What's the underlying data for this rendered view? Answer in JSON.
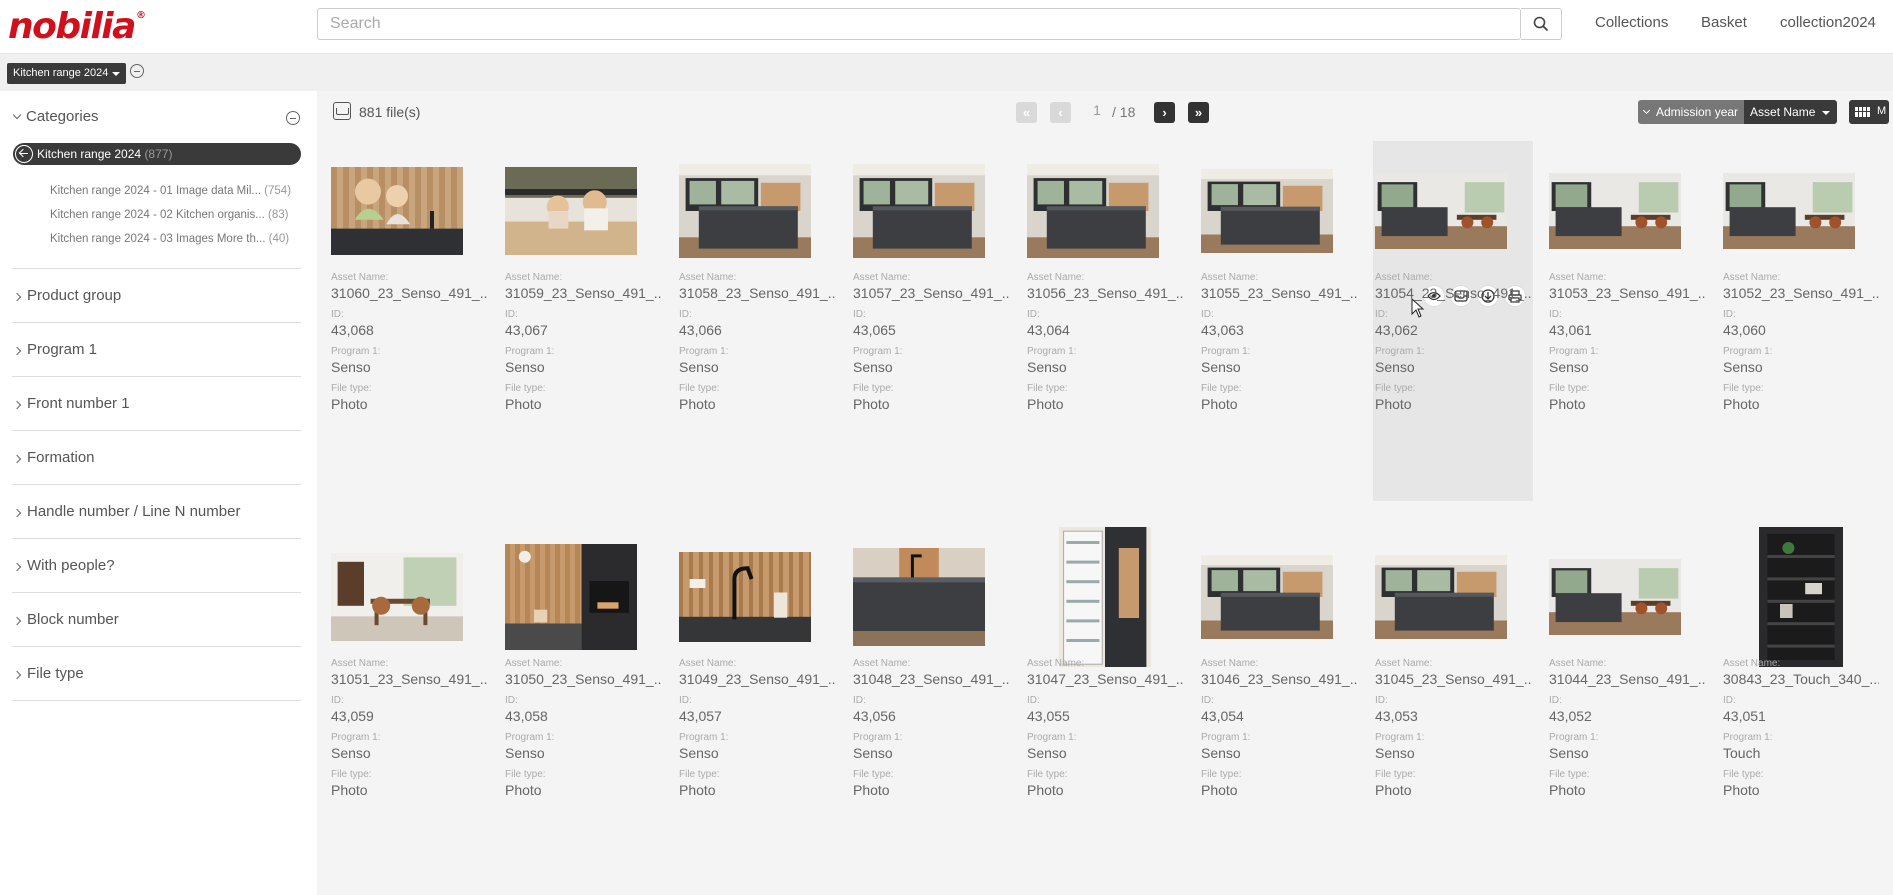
{
  "header": {
    "logo": "nobilia",
    "logo_mark": "®",
    "search_placeholder": "Search",
    "nav": [
      "Collections",
      "Basket",
      "collection2024"
    ]
  },
  "subbar": {
    "scope": "Kitchen range 2024"
  },
  "sidebar": {
    "categories_label": "Categories",
    "active": {
      "label": "Kitchen range 2024",
      "count": "(877)"
    },
    "subcategories": [
      {
        "label": "Kitchen range 2024 - 01 Image data Mil...",
        "count": "(754)"
      },
      {
        "label": "Kitchen range 2024 - 02 Kitchen organis...",
        "count": "(83)"
      },
      {
        "label": "Kitchen range 2024 - 03 Images More th...",
        "count": "(40)"
      }
    ],
    "filters": [
      "Product group",
      "Program 1",
      "Front number 1",
      "Formation",
      "Handle number / Line N number",
      "With people?",
      "Block number",
      "File type"
    ]
  },
  "toolbar": {
    "files_count": "881 file(s)",
    "page": "1",
    "page_total": "/ 18",
    "sort_admission": "Admission year",
    "sort_name": "Asset Name",
    "view_label": "M"
  },
  "labels": {
    "asset_name": "Asset Name:",
    "id": "ID:",
    "program": "Program 1:",
    "file_type": "File type:"
  },
  "assets": [
    {
      "name": "31060_23_Senso_491_...",
      "id": "43,068",
      "program": "Senso",
      "file_type": "Photo",
      "scene": "people-kitchen"
    },
    {
      "name": "31059_23_Senso_491_...",
      "id": "43,067",
      "program": "Senso",
      "file_type": "Photo",
      "scene": "people-table"
    },
    {
      "name": "31058_23_Senso_491_...",
      "id": "43,066",
      "program": "Senso",
      "file_type": "Photo",
      "scene": "island"
    },
    {
      "name": "31057_23_Senso_491_...",
      "id": "43,065",
      "program": "Senso",
      "file_type": "Photo",
      "scene": "island"
    },
    {
      "name": "31056_23_Senso_491_...",
      "id": "43,064",
      "program": "Senso",
      "file_type": "Photo",
      "scene": "island"
    },
    {
      "name": "31055_23_Senso_491_...",
      "id": "43,063",
      "program": "Senso",
      "file_type": "Photo",
      "scene": "island-wide"
    },
    {
      "name": "31054_23_Senso_491_...",
      "id": "43,062",
      "program": "Senso",
      "file_type": "Photo",
      "scene": "room"
    },
    {
      "name": "31053_23_Senso_491_...",
      "id": "43,061",
      "program": "Senso",
      "file_type": "Photo",
      "scene": "room"
    },
    {
      "name": "31052_23_Senso_491_...",
      "id": "43,060",
      "program": "Senso",
      "file_type": "Photo",
      "scene": "room"
    },
    {
      "name": "31051_23_Senso_491_...",
      "id": "43,059",
      "program": "Senso",
      "file_type": "Photo",
      "scene": "dining"
    },
    {
      "name": "31050_23_Senso_491_...",
      "id": "43,058",
      "program": "Senso",
      "file_type": "Photo",
      "scene": "oven"
    },
    {
      "name": "31049_23_Senso_491_...",
      "id": "43,057",
      "program": "Senso",
      "file_type": "Photo",
      "scene": "tap"
    },
    {
      "name": "31048_23_Senso_491_...",
      "id": "43,056",
      "program": "Senso",
      "file_type": "Photo",
      "scene": "corner"
    },
    {
      "name": "31047_23_Senso_491_...",
      "id": "43,055",
      "program": "Senso",
      "file_type": "Photo",
      "scene": "fridge"
    },
    {
      "name": "31046_23_Senso_491_...",
      "id": "43,054",
      "program": "Senso",
      "file_type": "Photo",
      "scene": "island-wide"
    },
    {
      "name": "31045_23_Senso_491_...",
      "id": "43,053",
      "program": "Senso",
      "file_type": "Photo",
      "scene": "island-wide"
    },
    {
      "name": "31044_23_Senso_491_...",
      "id": "43,052",
      "program": "Senso",
      "file_type": "Photo",
      "scene": "room"
    },
    {
      "name": "30843_23_Touch_340_...",
      "id": "43,051",
      "program": "Touch",
      "file_type": "Photo",
      "scene": "shelf"
    }
  ],
  "card_actions": [
    "eye-icon",
    "basket-icon",
    "download-icon",
    "print-icon"
  ],
  "colors": {
    "brand": "#d0101c",
    "dark": "#3a3a3a"
  }
}
